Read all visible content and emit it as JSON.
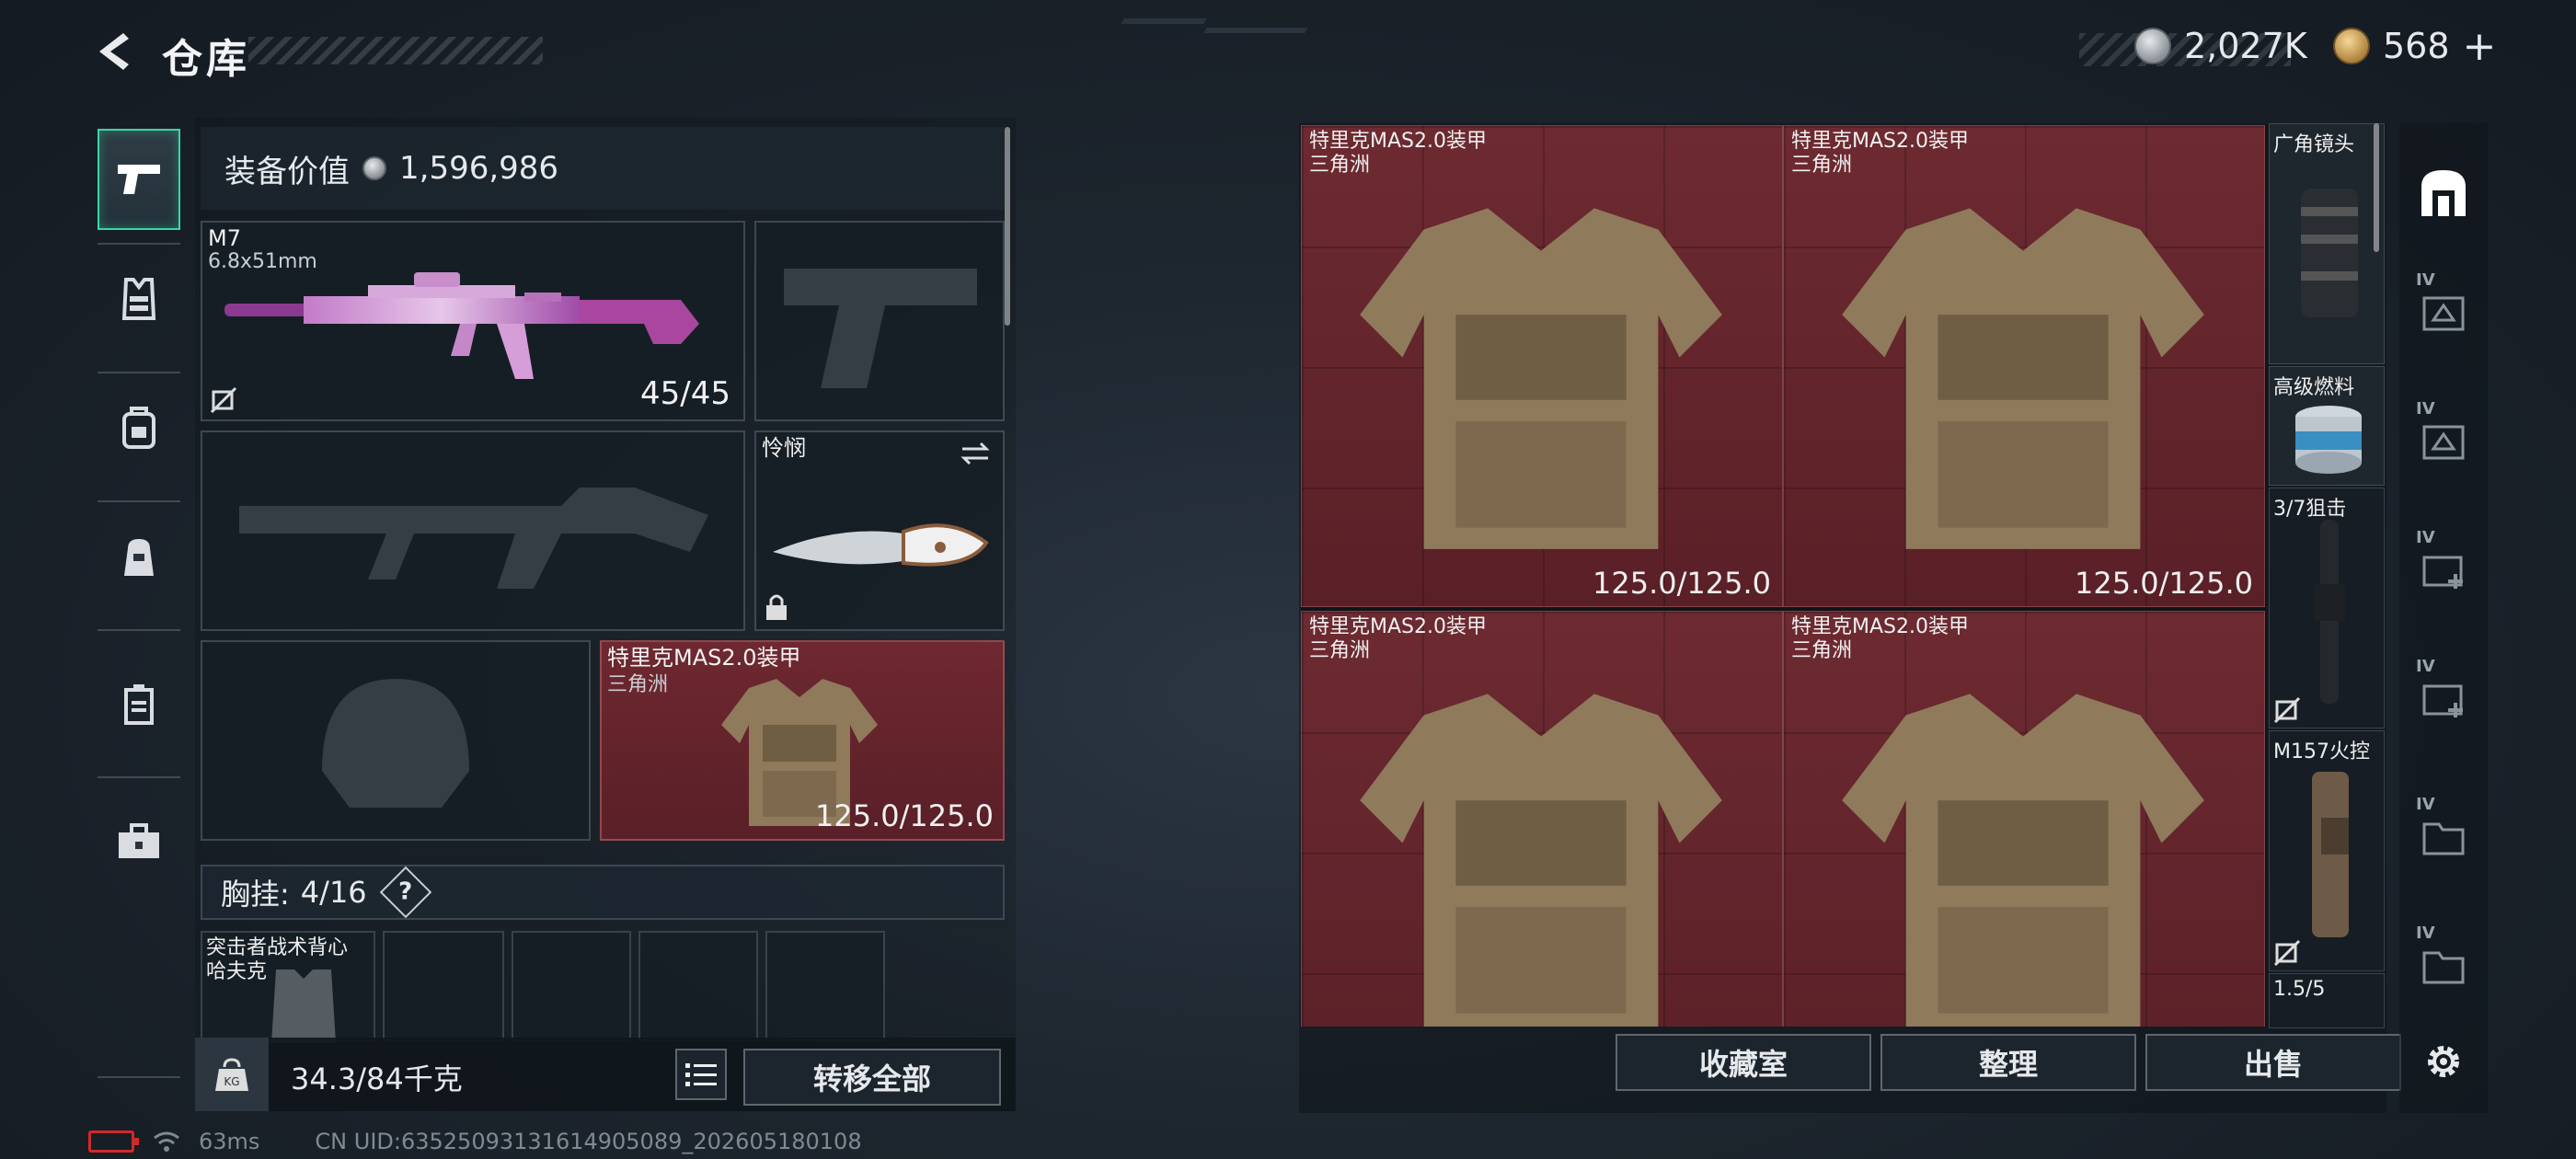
{
  "header": {
    "title": "仓库",
    "currency_primary": "2,027K",
    "currency_secondary": "568",
    "currency_add": "+"
  },
  "left_rail": {
    "items": [
      {
        "icon": "pistol-icon",
        "active": true
      },
      {
        "icon": "armor-vest-icon",
        "active": false
      },
      {
        "icon": "backpack-icon",
        "active": false
      },
      {
        "icon": "bag-icon",
        "active": false
      },
      {
        "icon": "container-icon",
        "active": false
      },
      {
        "icon": "toolbox-icon",
        "active": false
      }
    ]
  },
  "loadout": {
    "value_label": "装备价值",
    "value": "1,596,986",
    "primary_weapon": {
      "name": "M7",
      "caliber": "6.8x51mm",
      "ammo": "45/45"
    },
    "melee": {
      "name": "怜悯"
    },
    "armor": {
      "name": "特里克MAS2.0装甲",
      "sub": "三角洲",
      "durability": "125.0/125.0"
    },
    "rig": {
      "label": "胸挂:",
      "count": "4/16",
      "help": "?"
    },
    "rig_item": {
      "name": "突击者战术背心",
      "sub": "哈夫克"
    },
    "weight_current": "34.3",
    "weight_max": "/84千克",
    "transfer_all": "转移全部"
  },
  "storage": {
    "items": [
      {
        "name": "特里克MAS2.0装甲",
        "sub": "三角洲",
        "durability": "125.0/125.0"
      },
      {
        "name": "特里克MAS2.0装甲",
        "sub": "三角洲",
        "durability": "125.0/125.0"
      },
      {
        "name": "特里克MAS2.0装甲",
        "sub": "三角洲",
        "durability": ""
      },
      {
        "name": "特里克MAS2.0装甲",
        "sub": "三角洲",
        "durability": ""
      }
    ],
    "side_items": [
      {
        "name": "广角镜头"
      },
      {
        "name": "高级燃料"
      },
      {
        "name": "3/7狙击"
      },
      {
        "name": "M157火控"
      },
      {
        "name": "1.5/5"
      }
    ],
    "actions": {
      "collection": "收藏室",
      "sort": "整理",
      "sell": "出售"
    }
  },
  "filter_rail": {
    "tier_label": "IV"
  },
  "status_bar": {
    "ping": "63ms",
    "uid": "CN UID:6352509313161490​5089_202605180108"
  },
  "colors": {
    "accent": "#39d6a8",
    "item_red": "#6d2a31",
    "panel": "#1c252d"
  }
}
